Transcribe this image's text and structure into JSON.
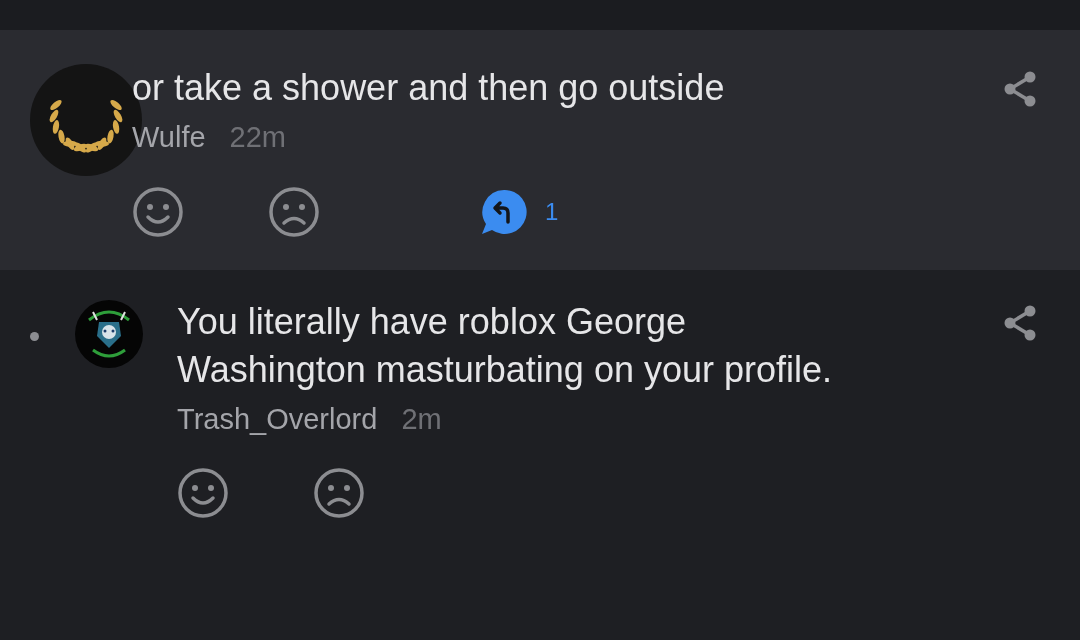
{
  "comments": [
    {
      "text": "or take a shower and then go outside",
      "author": "Wulfe",
      "time": "22m",
      "highlighted": true,
      "new": false,
      "avatar": {
        "kind": "laurel"
      },
      "replies": "1"
    },
    {
      "text": "You literally have roblox George Washington masturbating on your profile.",
      "author": "Trash_Overlord",
      "time": "2m",
      "highlighted": false,
      "new": true
    }
  ]
}
